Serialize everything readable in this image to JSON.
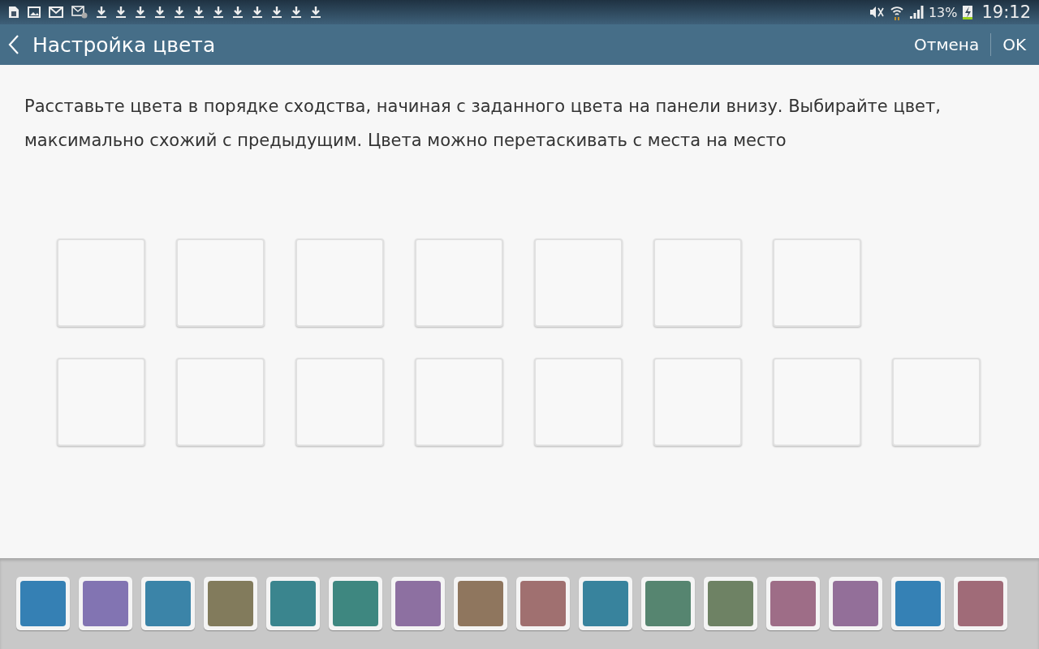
{
  "status_bar": {
    "battery": "13%",
    "time": "19:12"
  },
  "header": {
    "title": "Настройка цвета",
    "actions": [
      "Отмена",
      "OK"
    ]
  },
  "instruction": "Расставьте цвета в порядке сходства, начиная с заданного цвета на панели внизу. Выбирайте цвет, максимально схожий с предыдущим. Цвета можно перетаскивать с места на место",
  "palette": [
    {
      "color": "#3580b4"
    },
    {
      "color": "#8274b2"
    },
    {
      "color": "#3b84a8"
    },
    {
      "color": "#827b5c"
    },
    {
      "color": "#3a858e"
    },
    {
      "color": "#3e8780"
    },
    {
      "color": "#8d70a1"
    },
    {
      "color": "#8f765e"
    },
    {
      "color": "#a07070"
    },
    {
      "color": "#38839d"
    },
    {
      "color": "#568570"
    },
    {
      "color": "#6e8264"
    },
    {
      "color": "#9e6d87"
    },
    {
      "color": "#936f99"
    },
    {
      "color": "#3581b5"
    },
    {
      "color": "#a06b78"
    }
  ]
}
